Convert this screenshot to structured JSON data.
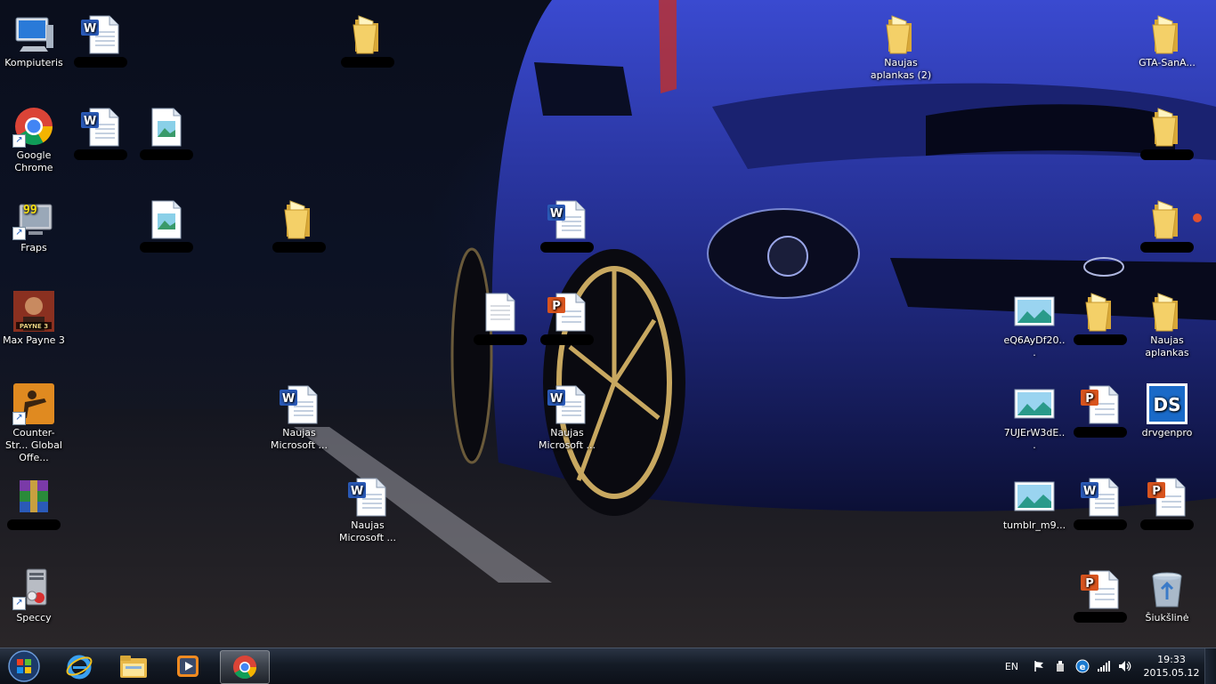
{
  "desktop": {
    "icons": [
      {
        "label": "Kompiuteris",
        "type": "computer"
      },
      {
        "label": "Google Chrome",
        "type": "chrome"
      },
      {
        "label": "Fraps",
        "type": "fraps"
      },
      {
        "label": "Max Payne 3",
        "type": "maxpayne"
      },
      {
        "label": "Counter-Str... Global Offe...",
        "type": "csgo"
      },
      {
        "label": "",
        "type": "winrar"
      },
      {
        "label": "Speccy",
        "type": "speccy"
      },
      {
        "label": "",
        "type": "word"
      },
      {
        "label": "",
        "type": "word"
      },
      {
        "label": "",
        "type": "doc-image"
      },
      {
        "label": "",
        "type": "doc-image"
      },
      {
        "label": "",
        "type": "folder"
      },
      {
        "label": "",
        "type": "folder"
      },
      {
        "label": "Naujas Microsoft ...",
        "type": "word"
      },
      {
        "label": "Naujas Microsoft ...",
        "type": "word"
      },
      {
        "label": "",
        "type": "word"
      },
      {
        "label": "",
        "type": "text"
      },
      {
        "label": "",
        "type": "powerpoint"
      },
      {
        "label": "Naujas Microsoft ...",
        "type": "word"
      },
      {
        "label": "Naujas aplankas (2)",
        "type": "folder"
      },
      {
        "label": "GTA-SanA...",
        "type": "folder"
      },
      {
        "label": "",
        "type": "folder"
      },
      {
        "label": "",
        "type": "folder"
      },
      {
        "label": "eQ6AyDf20...",
        "type": "image"
      },
      {
        "label": "",
        "type": "folder"
      },
      {
        "label": "Naujas aplankas",
        "type": "folder"
      },
      {
        "label": "7UJErW3dE...",
        "type": "image"
      },
      {
        "label": "",
        "type": "powerpoint"
      },
      {
        "label": "drvgenpro",
        "type": "ds"
      },
      {
        "label": "tumblr_m9...",
        "type": "image"
      },
      {
        "label": "",
        "type": "word"
      },
      {
        "label": "",
        "type": "powerpoint"
      },
      {
        "label": "",
        "type": "powerpoint"
      },
      {
        "label": "Šiukšlinė",
        "type": "recycle"
      }
    ]
  },
  "taskbar": {
    "pinned": [
      {
        "name": "internet-explorer"
      },
      {
        "name": "windows-explorer"
      },
      {
        "name": "media-player"
      },
      {
        "name": "google-chrome",
        "active": true
      }
    ],
    "tray": {
      "language": "EN",
      "time": "19:33",
      "date": "2015.05.12"
    }
  }
}
